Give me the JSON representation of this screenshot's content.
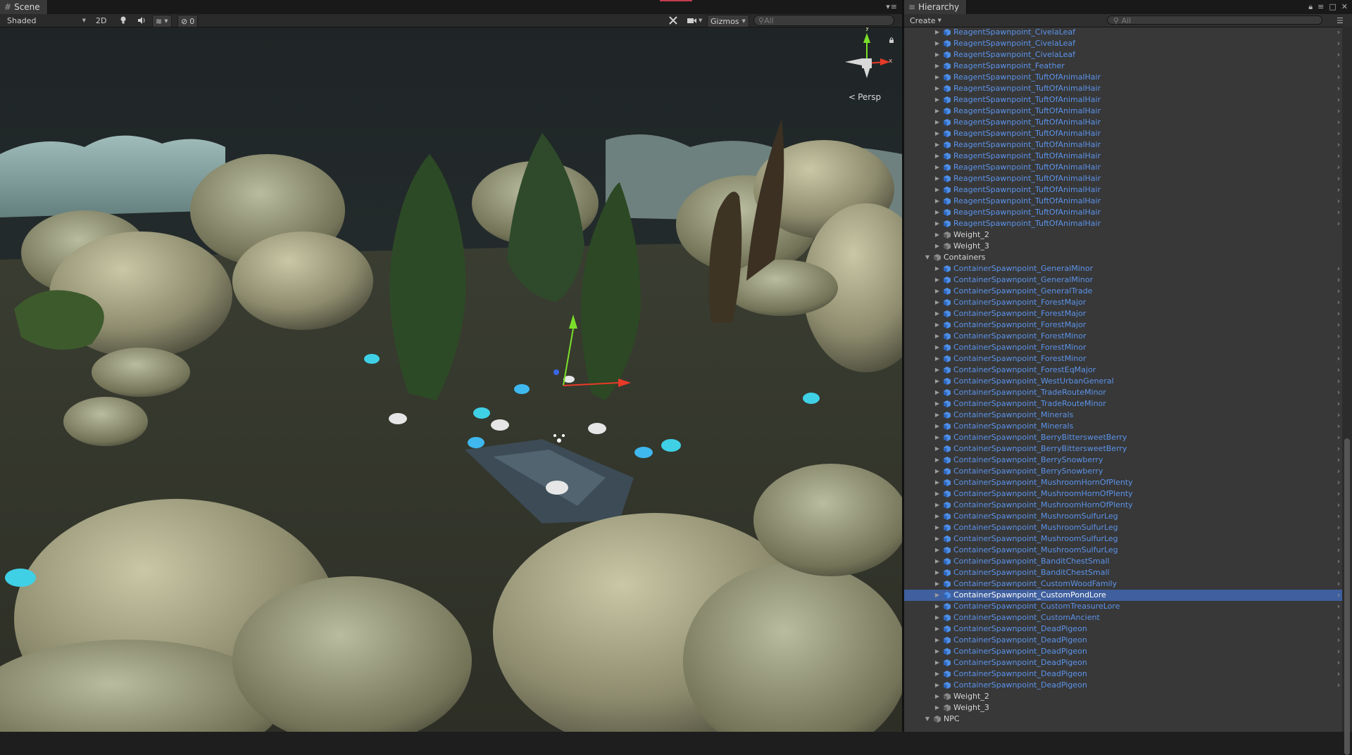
{
  "scene": {
    "tab_label": "Scene",
    "shading_mode": "Shaded",
    "mode_2d": "2D",
    "hidden_count": "0",
    "gizmos_label": "Gizmos",
    "search_placeholder": "All",
    "projection": "Persp",
    "gizmo_y": "y",
    "gizmo_x": "x"
  },
  "hierarchy": {
    "tab_label": "Hierarchy",
    "create_label": "Create",
    "search_placeholder": "All",
    "rows": [
      {
        "label": "ReagentSpawnpoint_CivelaLeaf",
        "type": "prefab",
        "indent": 2
      },
      {
        "label": "ReagentSpawnpoint_CivelaLeaf",
        "type": "prefab",
        "indent": 2
      },
      {
        "label": "ReagentSpawnpoint_CivelaLeaf",
        "type": "prefab",
        "indent": 2
      },
      {
        "label": "ReagentSpawnpoint_Feather",
        "type": "prefab",
        "indent": 2
      },
      {
        "label": "ReagentSpawnpoint_TuftOfAnimalHair",
        "type": "prefab",
        "indent": 2
      },
      {
        "label": "ReagentSpawnpoint_TuftOfAnimalHair",
        "type": "prefab",
        "indent": 2
      },
      {
        "label": "ReagentSpawnpoint_TuftOfAnimalHair",
        "type": "prefab",
        "indent": 2
      },
      {
        "label": "ReagentSpawnpoint_TuftOfAnimalHair",
        "type": "prefab",
        "indent": 2
      },
      {
        "label": "ReagentSpawnpoint_TuftOfAnimalHair",
        "type": "prefab",
        "indent": 2
      },
      {
        "label": "ReagentSpawnpoint_TuftOfAnimalHair",
        "type": "prefab",
        "indent": 2
      },
      {
        "label": "ReagentSpawnpoint_TuftOfAnimalHair",
        "type": "prefab",
        "indent": 2
      },
      {
        "label": "ReagentSpawnpoint_TuftOfAnimalHair",
        "type": "prefab",
        "indent": 2
      },
      {
        "label": "ReagentSpawnpoint_TuftOfAnimalHair",
        "type": "prefab",
        "indent": 2
      },
      {
        "label": "ReagentSpawnpoint_TuftOfAnimalHair",
        "type": "prefab",
        "indent": 2
      },
      {
        "label": "ReagentSpawnpoint_TuftOfAnimalHair",
        "type": "prefab",
        "indent": 2
      },
      {
        "label": "ReagentSpawnpoint_TuftOfAnimalHair",
        "type": "prefab",
        "indent": 2
      },
      {
        "label": "ReagentSpawnpoint_TuftOfAnimalHair",
        "type": "prefab",
        "indent": 2
      },
      {
        "label": "ReagentSpawnpoint_TuftOfAnimalHair",
        "type": "prefab",
        "indent": 2
      },
      {
        "label": "Weight_2",
        "type": "plain",
        "indent": 2,
        "foldout": "collapsed"
      },
      {
        "label": "Weight_3",
        "type": "plain",
        "indent": 2,
        "foldout": "collapsed"
      },
      {
        "label": "Containers",
        "type": "plain",
        "indent": 1,
        "foldout": "expanded"
      },
      {
        "label": "ContainerSpawnpoint_GeneralMinor",
        "type": "prefab",
        "indent": 2
      },
      {
        "label": "ContainerSpawnpoint_GeneralMinor",
        "type": "prefab",
        "indent": 2
      },
      {
        "label": "ContainerSpawnpoint_GeneralTrade",
        "type": "prefab",
        "indent": 2
      },
      {
        "label": "ContainerSpawnpoint_ForestMajor",
        "type": "prefab",
        "indent": 2
      },
      {
        "label": "ContainerSpawnpoint_ForestMajor",
        "type": "prefab",
        "indent": 2
      },
      {
        "label": "ContainerSpawnpoint_ForestMajor",
        "type": "prefab",
        "indent": 2
      },
      {
        "label": "ContainerSpawnpoint_ForestMinor",
        "type": "prefab",
        "indent": 2
      },
      {
        "label": "ContainerSpawnpoint_ForestMinor",
        "type": "prefab",
        "indent": 2
      },
      {
        "label": "ContainerSpawnpoint_ForestMinor",
        "type": "prefab",
        "indent": 2
      },
      {
        "label": "ContainerSpawnpoint_ForestEqMajor",
        "type": "prefab",
        "indent": 2
      },
      {
        "label": "ContainerSpawnpoint_WestUrbanGeneral",
        "type": "prefab",
        "indent": 2
      },
      {
        "label": "ContainerSpawnpoint_TradeRouteMinor",
        "type": "prefab",
        "indent": 2
      },
      {
        "label": "ContainerSpawnpoint_TradeRouteMinor",
        "type": "prefab",
        "indent": 2
      },
      {
        "label": "ContainerSpawnpoint_Minerals",
        "type": "prefab",
        "indent": 2
      },
      {
        "label": "ContainerSpawnpoint_Minerals",
        "type": "prefab",
        "indent": 2
      },
      {
        "label": "ContainerSpawnpoint_BerryBittersweetBerry",
        "type": "prefab",
        "indent": 2
      },
      {
        "label": "ContainerSpawnpoint_BerryBittersweetBerry",
        "type": "prefab",
        "indent": 2
      },
      {
        "label": "ContainerSpawnpoint_BerrySnowberry",
        "type": "prefab",
        "indent": 2
      },
      {
        "label": "ContainerSpawnpoint_BerrySnowberry",
        "type": "prefab",
        "indent": 2
      },
      {
        "label": "ContainerSpawnpoint_MushroomHornOfPlenty",
        "type": "prefab",
        "indent": 2
      },
      {
        "label": "ContainerSpawnpoint_MushroomHornOfPlenty",
        "type": "prefab",
        "indent": 2
      },
      {
        "label": "ContainerSpawnpoint_MushroomHornOfPlenty",
        "type": "prefab",
        "indent": 2
      },
      {
        "label": "ContainerSpawnpoint_MushroomSulfurLeg",
        "type": "prefab",
        "indent": 2
      },
      {
        "label": "ContainerSpawnpoint_MushroomSulfurLeg",
        "type": "prefab",
        "indent": 2
      },
      {
        "label": "ContainerSpawnpoint_MushroomSulfurLeg",
        "type": "prefab",
        "indent": 2
      },
      {
        "label": "ContainerSpawnpoint_MushroomSulfurLeg",
        "type": "prefab",
        "indent": 2
      },
      {
        "label": "ContainerSpawnpoint_BanditChestSmall",
        "type": "prefab",
        "indent": 2
      },
      {
        "label": "ContainerSpawnpoint_BanditChestSmall",
        "type": "prefab",
        "indent": 2
      },
      {
        "label": "ContainerSpawnpoint_CustomWoodFamily",
        "type": "prefab",
        "indent": 2
      },
      {
        "label": "ContainerSpawnpoint_CustomPondLore",
        "type": "prefab",
        "indent": 2,
        "selected": true
      },
      {
        "label": "ContainerSpawnpoint_CustomTreasureLore",
        "type": "prefab",
        "indent": 2
      },
      {
        "label": "ContainerSpawnpoint_CustomAncient",
        "type": "prefab",
        "indent": 2
      },
      {
        "label": "ContainerSpawnpoint_DeadPigeon",
        "type": "prefab",
        "indent": 2
      },
      {
        "label": "ContainerSpawnpoint_DeadPigeon",
        "type": "prefab",
        "indent": 2
      },
      {
        "label": "ContainerSpawnpoint_DeadPigeon",
        "type": "prefab",
        "indent": 2
      },
      {
        "label": "ContainerSpawnpoint_DeadPigeon",
        "type": "prefab",
        "indent": 2
      },
      {
        "label": "ContainerSpawnpoint_DeadPigeon",
        "type": "prefab",
        "indent": 2
      },
      {
        "label": "ContainerSpawnpoint_DeadPigeon",
        "type": "prefab",
        "indent": 2
      },
      {
        "label": "Weight_2",
        "type": "plain",
        "indent": 2,
        "foldout": "collapsed"
      },
      {
        "label": "Weight_3",
        "type": "plain",
        "indent": 2,
        "foldout": "collapsed"
      },
      {
        "label": "NPC",
        "type": "plain",
        "indent": 1,
        "foldout": "expanded"
      }
    ]
  },
  "colors": {
    "prefab_text": "#5b93ea",
    "selection": "#3f5f9e",
    "panel_bg": "#383838"
  }
}
